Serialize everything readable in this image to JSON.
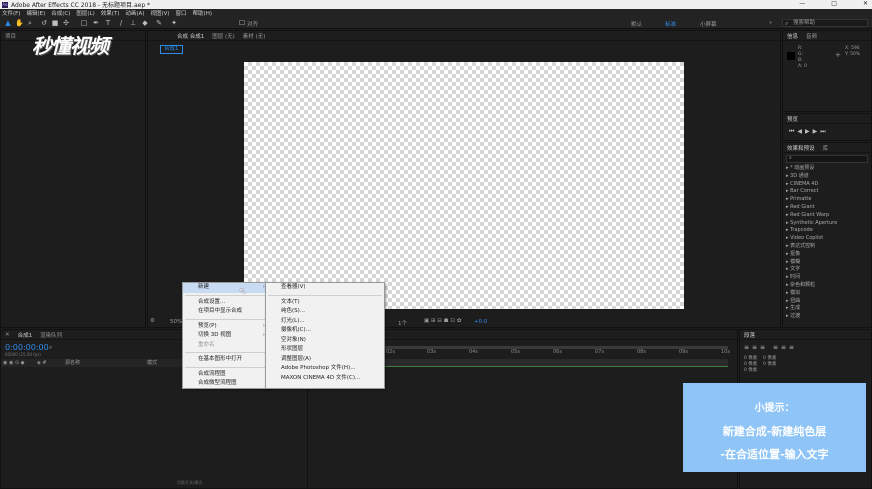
{
  "window": {
    "title": "Adobe After Effects CC 2018 - 无标题项目.aep *",
    "controls": [
      "—",
      "□",
      "✕"
    ]
  },
  "menu": [
    "文件(F)",
    "编辑(E)",
    "合成(C)",
    "图层(L)",
    "效果(T)",
    "动画(A)",
    "视图(V)",
    "窗口",
    "帮助(H)"
  ],
  "toolbar": {
    "tools": [
      "selection-tool",
      "hand-tool",
      "zoom-tool",
      "rotate-tool",
      "camera-tool",
      "pan-behind-tool",
      "rectangle-tool",
      "pen-tool",
      "text-tool",
      "brush-tool",
      "clone-stamp-tool",
      "eraser-tool",
      "roto-brush-tool",
      "puppet-tool"
    ],
    "snap_label": "对齐",
    "workspaces": [
      "默认",
      "标准",
      "小屏幕"
    ],
    "active_workspace": "标准",
    "search_placeholder": "搜索帮助"
  },
  "project_panel": {
    "tab": "项目"
  },
  "composition_panel": {
    "tab": "合成 合成1",
    "tab_layer": "图层 (无)",
    "tab_footage": "素材 (无)",
    "breadcrumb": "合成1"
  },
  "viewer_footer": {
    "zoom": "50%",
    "view": "1个",
    "offset": "+0.0"
  },
  "info_panel": {
    "tabs": [
      "信息",
      "音频"
    ],
    "r": "R:",
    "g": "G:",
    "b": "B:",
    "a": "A: 0",
    "x": "X: 596",
    "y": "Y: 50%"
  },
  "preview_panel": {
    "tab": "预览"
  },
  "effects_panel": {
    "tabs": [
      "效果和预设",
      "库"
    ],
    "search_placeholder": "",
    "items": [
      "* 动画预设",
      "3D 通道",
      "CINEMA 4D",
      "Bar Correct",
      "Primatte",
      "Red Giant",
      "Red Giant Warp",
      "Synthetic Aperture",
      "Trapcode",
      "Video Copilot",
      "表达式控制",
      "抠像",
      "模糊",
      "文字",
      "时间",
      "杂色和颗粒",
      "模拟",
      "扭曲",
      "生成",
      "过渡",
      "透视",
      "通道",
      "遮罩",
      "音频",
      "颜色校正",
      "风格化",
      "沉浸式视频"
    ]
  },
  "timeline": {
    "tab": "合成1",
    "queue_tab": "渲染队列",
    "timecode": "0:00:00:00",
    "timecode_sub": "00000 (25.00 fps)",
    "col_source": "源名称",
    "col_mode": "模式",
    "ruler": [
      "0s",
      "02s",
      "03s",
      "04s",
      "05s",
      "06s",
      "07s",
      "08s",
      "09s",
      "10s"
    ],
    "footer": "切换开关/模式"
  },
  "align_panel": {
    "tab": "段落",
    "values": [
      "0 像素",
      "0 像素",
      "0 像素",
      "0 像素",
      "0 像素"
    ]
  },
  "context_menu_main": [
    {
      "label": "新建",
      "submenu": true,
      "hl": true
    },
    {
      "sep": true
    },
    {
      "label": "合成设置..."
    },
    {
      "label": "在项目中显示合成"
    },
    {
      "sep": true
    },
    {
      "label": "预览(P)",
      "submenu": true
    },
    {
      "label": "切换 3D 视图",
      "submenu": true
    },
    {
      "label": "重命名",
      "dis": true
    },
    {
      "sep": true
    },
    {
      "label": "在基本图形中打开"
    },
    {
      "sep": true
    },
    {
      "label": "合成流程图"
    },
    {
      "label": "合成微型流程图"
    }
  ],
  "context_menu_sub": [
    "查看器(V)",
    "文本(T)",
    "纯色(S)...",
    "灯光(L)...",
    "摄像机(C)...",
    "空对象(N)",
    "形状图层",
    "调整图层(A)",
    "Adobe Photoshop 文件(H)...",
    "MAXON CINEMA 4D 文件(C)..."
  ],
  "overlay": {
    "logo": "秒懂视频",
    "tip_title": "小提示：",
    "tip_line1": "新建合成-新建纯色层",
    "tip_line2": "-在合适位置-输入文字"
  },
  "colors": {
    "accent": "#2d8ceb",
    "tip_bg": "#8ec4f6",
    "timecode": "#2d8ceb"
  }
}
